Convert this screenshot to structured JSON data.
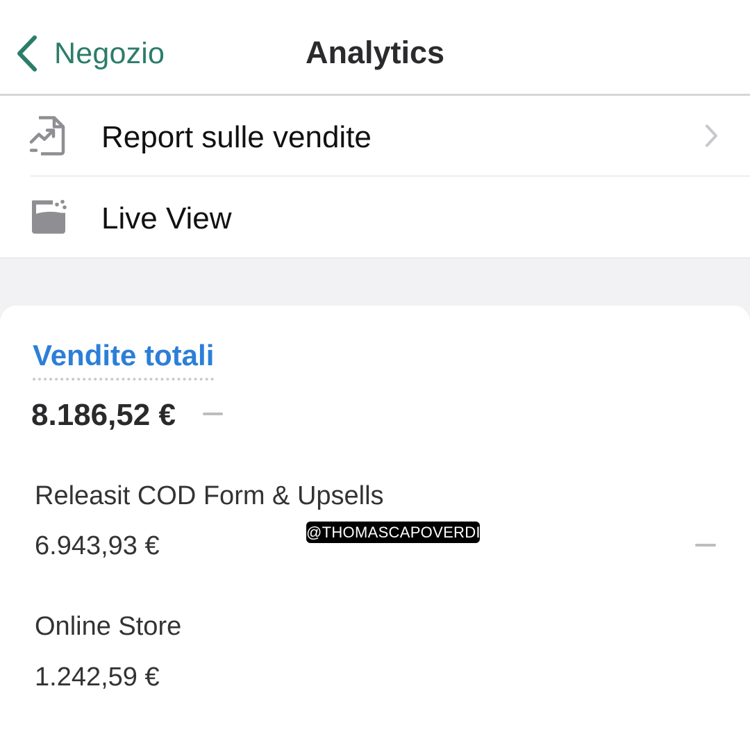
{
  "header": {
    "back_label": "Negozio",
    "title": "Analytics"
  },
  "menu": {
    "items": [
      {
        "label": "Report sulle vendite",
        "icon": "sales-report-icon",
        "has_chevron": true
      },
      {
        "label": "Live View",
        "icon": "live-view-icon",
        "has_chevron": false
      }
    ]
  },
  "sales_card": {
    "title": "Vendite totali",
    "total": "8.186,52 €",
    "channels": [
      {
        "name": "Releasit COD Form & Upsells",
        "value": "6.943,93 €"
      },
      {
        "name": "Online Store",
        "value": "1.242,59 €"
      }
    ]
  },
  "watermark": "@THOMASCAPOVERDI",
  "colors": {
    "accent_green": "#2c7c6a",
    "link_blue": "#2c7fd8",
    "icon_gray": "#8e8e93",
    "background_gray": "#f2f2f4"
  }
}
